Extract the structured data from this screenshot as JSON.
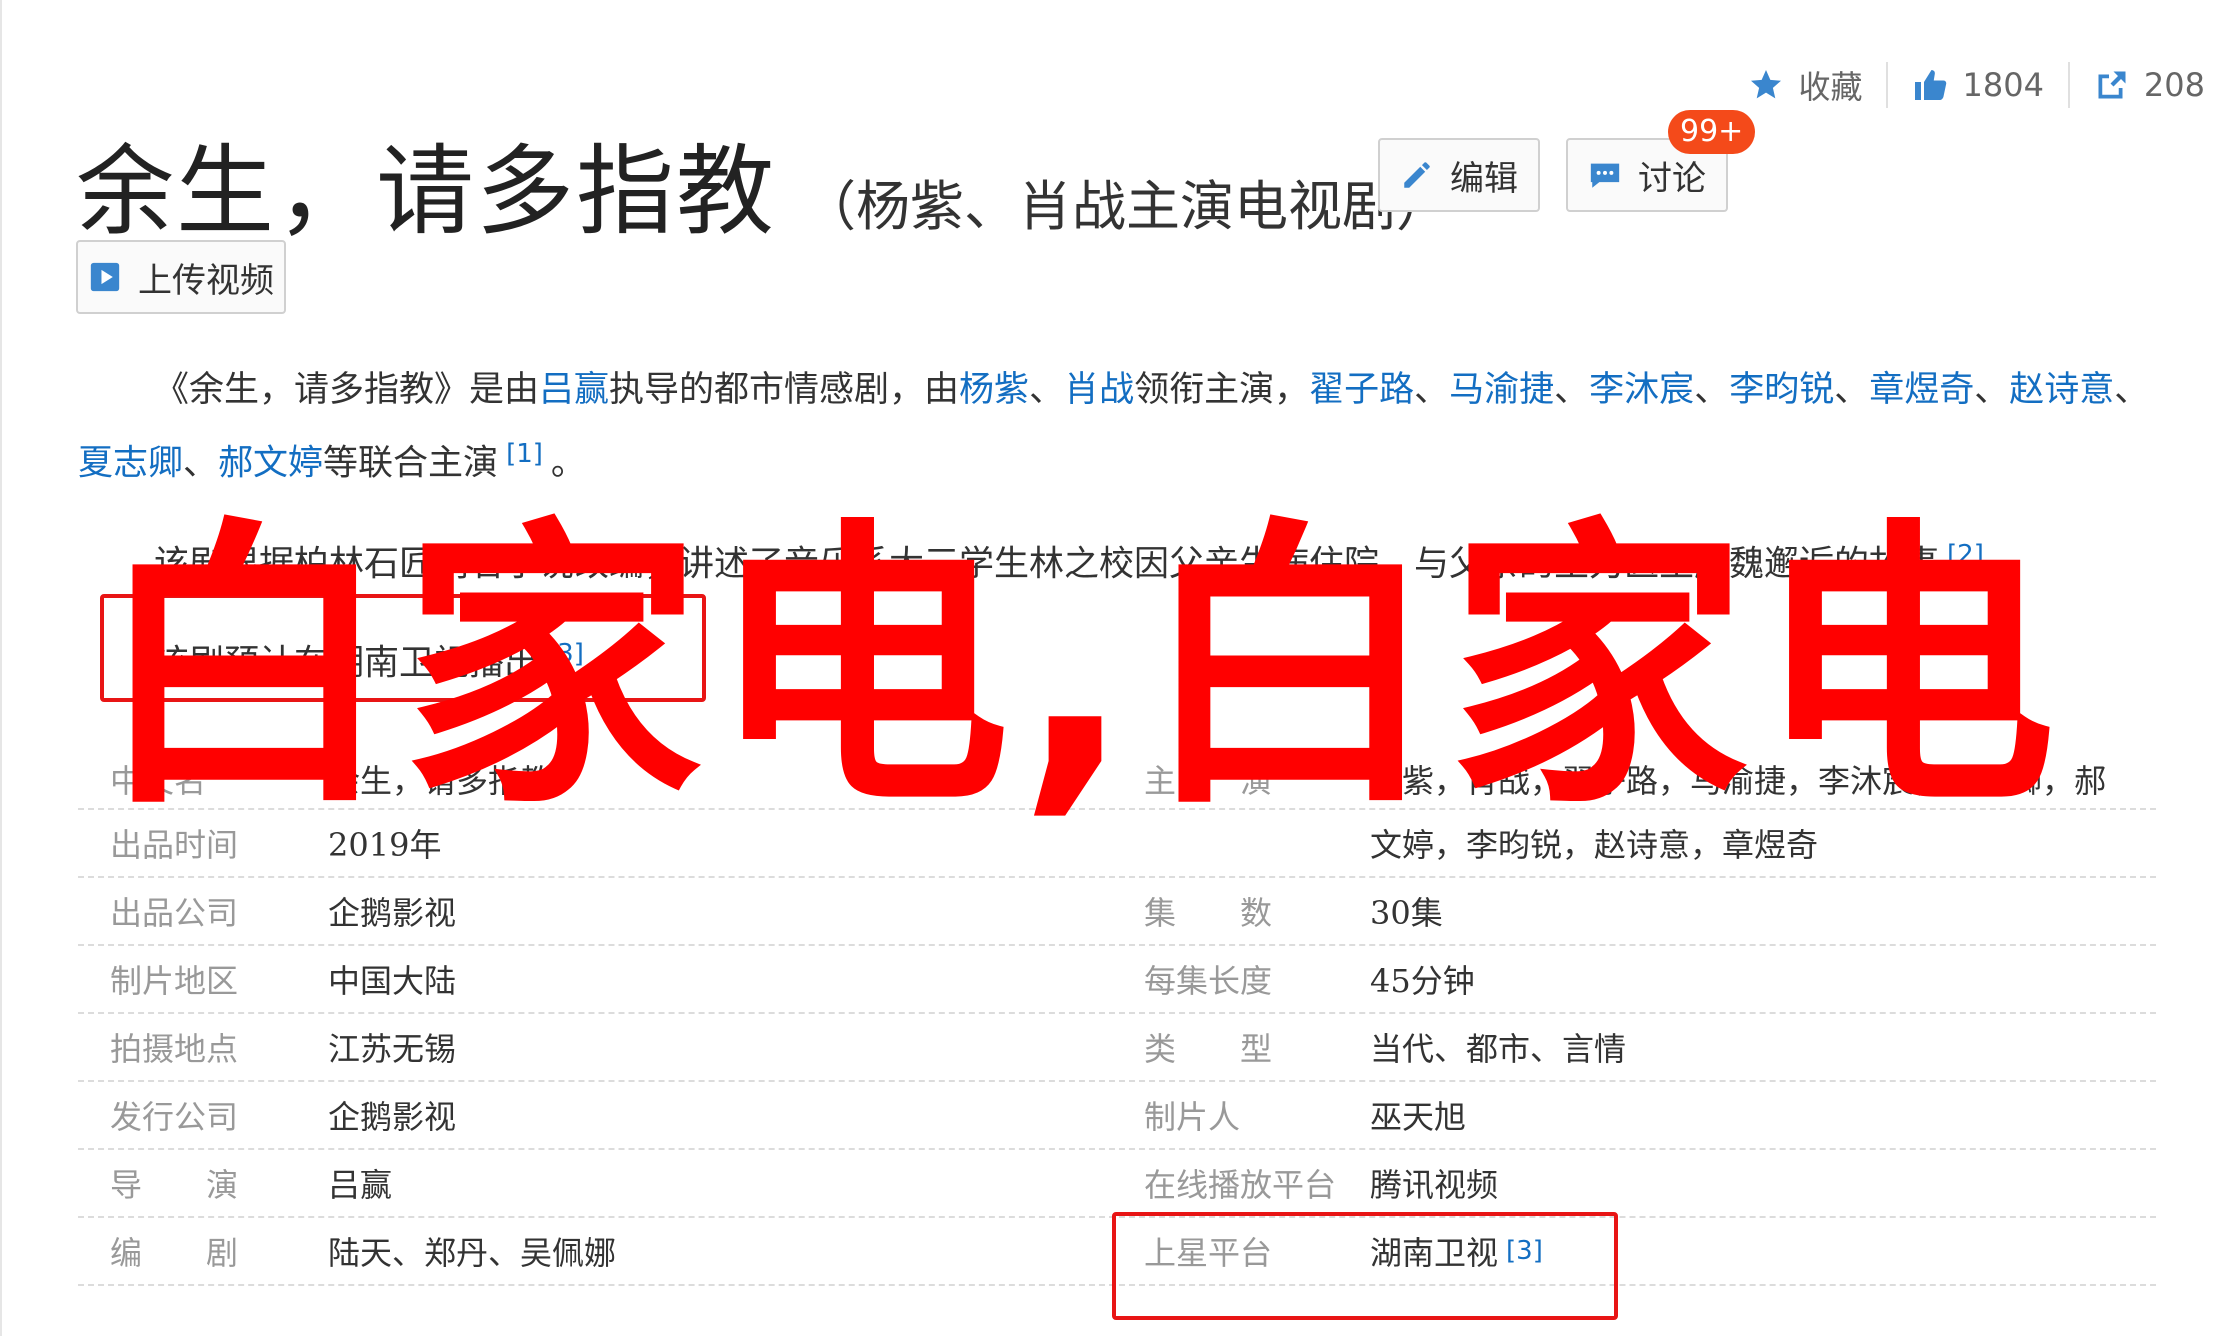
{
  "stats": {
    "favorite_label": "收藏",
    "likes": "1804",
    "shares": "208"
  },
  "title": {
    "main": "余生，请多指教",
    "sub": "（杨紫、肖战主演电视剧）"
  },
  "buttons": {
    "edit": "编辑",
    "discuss": "讨论",
    "discuss_badge": "99+",
    "upload": "上传视频"
  },
  "paragraphs": {
    "p1": {
      "t1": "《余生，请多指教》是由",
      "director": "吕赢",
      "t2": "执导的都市情感剧，由",
      "a1": "杨紫",
      "s1": "、",
      "a2": "肖战",
      "t3": "领衔主演，",
      "a3": "翟子路",
      "s2": "、",
      "a4": "马渝捷",
      "s3": "、",
      "a5": "李沐宸",
      "s4": "、",
      "a6": "李昀锐",
      "s5": "、",
      "a7": "章煜奇",
      "s6": "、",
      "a8": "赵诗意",
      "s7": "、",
      "a9": "夏志卿",
      "s8": "、",
      "a10": "郝文婷",
      "t4": "等联合主演",
      "ref": "[1]",
      "end": "。"
    },
    "p2": {
      "text": "该剧根据柏林石匠同名小说改编，讲述了音乐系大三学生林之校因父亲生病住院，与父亲的主刀医生顾魏邂逅的故事",
      "ref": "[2]",
      "end": "。"
    },
    "p3": {
      "text": "该剧预计在湖南卫视播出",
      "ref": "[3]",
      "end": "。"
    }
  },
  "info": {
    "rows": [
      {
        "l_label": "中文名",
        "l_value": "余生，请多指教",
        "r_label": "主　　演",
        "r_value": "杨紫，肖战，翟子路，马渝捷，李沐宸，夏志卿，郝",
        "r_value_2": "文婷，李昀锐，赵诗意，章煜奇"
      },
      {
        "l_label": "出品时间",
        "l_value": "2019年"
      },
      {
        "l_label": "出品公司",
        "l_value": "企鹅影视",
        "r_label": "集　　数",
        "r_value": "30集"
      },
      {
        "l_label": "制片地区",
        "l_value": "中国大陆",
        "r_label": "每集长度",
        "r_value": "45分钟"
      },
      {
        "l_label": "拍摄地点",
        "l_value": "江苏无锡",
        "r_label": "类　　型",
        "r_value": "当代、都市、言情"
      },
      {
        "l_label": "发行公司",
        "l_value": "企鹅影视",
        "r_label": "制片人",
        "r_value": "巫天旭"
      },
      {
        "l_label": "导　　演",
        "l_value": "吕赢",
        "r_label": "在线播放平台",
        "r_value": "腾讯视频"
      },
      {
        "l_label": "编　　剧",
        "l_value": "陆天、郑丹、吴佩娜",
        "r_label": "上星平台",
        "r_value": "湖南卫视",
        "r_ref": "[3]"
      }
    ]
  },
  "watermark": "白家电,白家电",
  "colors": {
    "link": "#136ec2",
    "accent_icon": "#3a86ce",
    "badge": "#f44a1a",
    "annotation": "#e81515",
    "watermark": "#ff0000"
  }
}
